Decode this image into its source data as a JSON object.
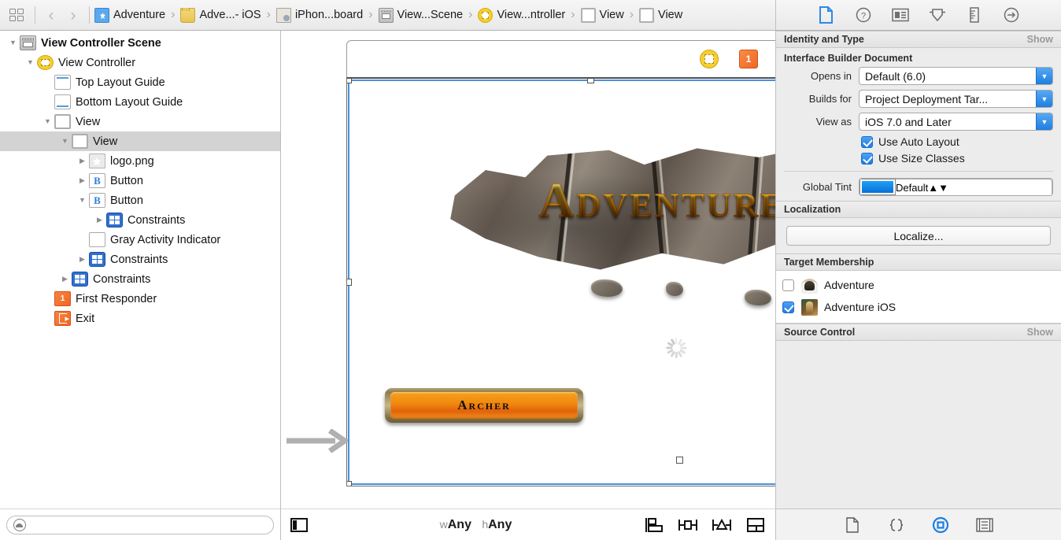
{
  "topbar": {
    "related_items_icon": "grid-icon",
    "back_label": "‹",
    "forward_label": "›",
    "breadcrumbs": [
      {
        "label": "Adventure",
        "icon": "storyboard-project-icon"
      },
      {
        "label": "Adve...- iOS",
        "icon": "folder-icon"
      },
      {
        "label": "iPhon...board",
        "icon": "storyboard-document-icon"
      },
      {
        "label": "View...Scene",
        "icon": "scene-icon"
      },
      {
        "label": "View...ntroller",
        "icon": "view-controller-icon"
      },
      {
        "label": "View",
        "icon": "view-icon"
      },
      {
        "label": "View",
        "icon": "view-icon"
      }
    ],
    "inspector_tabs": [
      {
        "name": "file-inspector",
        "selected": true
      },
      {
        "name": "quick-help-inspector",
        "selected": false
      },
      {
        "name": "identity-inspector",
        "selected": false
      },
      {
        "name": "attributes-inspector",
        "selected": false
      },
      {
        "name": "size-inspector",
        "selected": false
      },
      {
        "name": "connections-inspector",
        "selected": false
      }
    ]
  },
  "outline": {
    "rows": [
      {
        "label": "View Controller Scene",
        "indent": 0,
        "twisty": "down",
        "icon": "scene-icon",
        "bold": true,
        "selected": false
      },
      {
        "label": "View Controller",
        "indent": 1,
        "twisty": "down",
        "icon": "view-controller-icon",
        "bold": false,
        "selected": false
      },
      {
        "label": "Top Layout Guide",
        "indent": 2,
        "twisty": "none",
        "icon": "top-layout-guide-icon",
        "bold": false,
        "selected": false
      },
      {
        "label": "Bottom Layout Guide",
        "indent": 2,
        "twisty": "none",
        "icon": "bottom-layout-guide-icon",
        "bold": false,
        "selected": false
      },
      {
        "label": "View",
        "indent": 2,
        "twisty": "down",
        "icon": "view-icon",
        "bold": false,
        "selected": false
      },
      {
        "label": "View",
        "indent": 3,
        "twisty": "down",
        "icon": "view-icon",
        "bold": false,
        "selected": true
      },
      {
        "label": "logo.png",
        "indent": 4,
        "twisty": "right",
        "icon": "image-view-icon",
        "bold": false,
        "selected": false
      },
      {
        "label": "Button",
        "indent": 4,
        "twisty": "right",
        "icon": "button-icon",
        "bold": false,
        "selected": false
      },
      {
        "label": "Button",
        "indent": 4,
        "twisty": "down",
        "icon": "button-icon",
        "bold": false,
        "selected": false
      },
      {
        "label": "Constraints",
        "indent": 5,
        "twisty": "right",
        "icon": "constraints-icon",
        "bold": false,
        "selected": false
      },
      {
        "label": "Gray Activity Indicator",
        "indent": 4,
        "twisty": "none",
        "icon": "activity-indicator-icon",
        "bold": false,
        "selected": false
      },
      {
        "label": "Constraints",
        "indent": 4,
        "twisty": "right",
        "icon": "constraints-icon",
        "bold": false,
        "selected": false
      },
      {
        "label": "Constraints",
        "indent": 3,
        "twisty": "right",
        "icon": "constraints-icon",
        "bold": false,
        "selected": false
      },
      {
        "label": "First Responder",
        "indent": 2,
        "twisty": "none",
        "icon": "first-responder-icon",
        "bold": false,
        "selected": false
      },
      {
        "label": "Exit",
        "indent": 2,
        "twisty": "none",
        "icon": "exit-icon",
        "bold": false,
        "selected": false
      }
    ],
    "filter_placeholder": "",
    "filter_value": "",
    "filter_icon": "filter-icon"
  },
  "canvas": {
    "dock_icons": [
      {
        "name": "view-controller-dock-icon"
      },
      {
        "name": "first-responder-dock-icon"
      },
      {
        "name": "exit-dock-icon"
      }
    ],
    "logo_text": "Adventure",
    "button_label": "Archer",
    "activity_indicator": "gray-activity-indicator",
    "entry_point": "storyboard-entry-point-arrow",
    "bottom": {
      "panel_toggle_icon": "view-mode-toggle-icon",
      "size_class_w_prefix": "w",
      "size_class_w_value": "Any",
      "size_class_h_prefix": "h",
      "size_class_h_value": "Any",
      "autolayout_buttons": [
        {
          "name": "align-button"
        },
        {
          "name": "pin-button"
        },
        {
          "name": "resolve-auto-layout-issues-button"
        },
        {
          "name": "embed-in-button"
        }
      ]
    }
  },
  "inspector": {
    "identity_section": {
      "title": "Identity and Type",
      "show_label": "Show"
    },
    "ib_document": {
      "title": "Interface Builder Document",
      "fields": [
        {
          "label": "Opens in",
          "value": "Default (6.0)",
          "control": "popup"
        },
        {
          "label": "Builds for",
          "value": "Project Deployment Tar...",
          "control": "popup"
        },
        {
          "label": "View as",
          "value": "iOS 7.0 and Later",
          "control": "popup"
        }
      ],
      "checkboxes": [
        {
          "label": "Use Auto Layout",
          "checked": true
        },
        {
          "label": "Use Size Classes",
          "checked": true
        }
      ],
      "global_tint": {
        "label": "Global Tint",
        "value": "Default",
        "swatch_color": "#0f7fe0"
      }
    },
    "localization": {
      "title": "Localization",
      "button_label": "Localize..."
    },
    "target_membership": {
      "title": "Target Membership",
      "targets": [
        {
          "label": "Adventure",
          "checked": false,
          "icon": "adventure-mac-target-icon"
        },
        {
          "label": "Adventure iOS",
          "checked": true,
          "icon": "adventure-ios-target-icon"
        }
      ]
    },
    "source_control": {
      "title": "Source Control",
      "show_label": "Show"
    },
    "library_tabs": [
      {
        "name": "file-template-library",
        "selected": false
      },
      {
        "name": "code-snippet-library",
        "selected": false
      },
      {
        "name": "object-library",
        "selected": true
      },
      {
        "name": "media-library",
        "selected": false
      }
    ]
  }
}
